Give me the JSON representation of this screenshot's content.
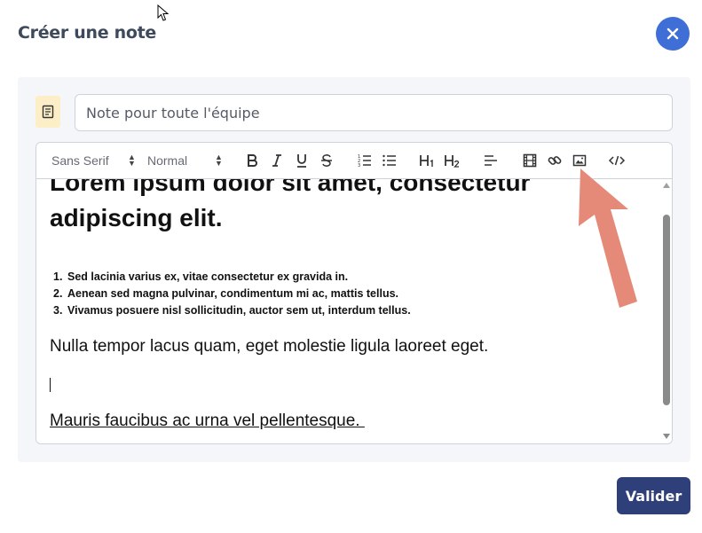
{
  "dialog": {
    "title": "Créer une note",
    "close_icon": "close-icon",
    "submit_label": "Valider"
  },
  "note": {
    "icon": "note-icon",
    "title_value": "Note pour toute l'équipe"
  },
  "toolbar": {
    "font_picker": "Sans Serif",
    "size_picker": "Normal",
    "buttons": [
      "bold-icon",
      "italic-icon",
      "underline-icon",
      "strikethrough-icon",
      "ordered-list-icon",
      "bullet-list-icon",
      "heading-1-icon",
      "heading-2-icon",
      "align-icon",
      "video-icon",
      "link-icon",
      "image-icon",
      "code-icon"
    ]
  },
  "content": {
    "heading_line1": "Lorem ipsum dolor sit amet, consectetur",
    "heading_line2": "adipiscing elit.",
    "list": [
      {
        "num": "1.",
        "text": "Sed lacinia varius ex, vitae consectetur ex gravida in."
      },
      {
        "num": "2.",
        "text": "Aenean sed magna pulvinar, condimentum mi ac, mattis tellus."
      },
      {
        "num": "3.",
        "text": "Vivamus posuere nisl sollicitudin, auctor sem ut, interdum tellus."
      }
    ],
    "paragraph": "Nulla tempor lacus quam, eget molestie ligula laoreet eget.",
    "underlined": "Mauris faucibus ac urna vel pellentesque. "
  },
  "colors": {
    "close_button": "#3f6fd6",
    "submit_button": "#2e3f7a",
    "annotation_arrow": "#e58a79",
    "icon_box": "#fcefc7"
  }
}
